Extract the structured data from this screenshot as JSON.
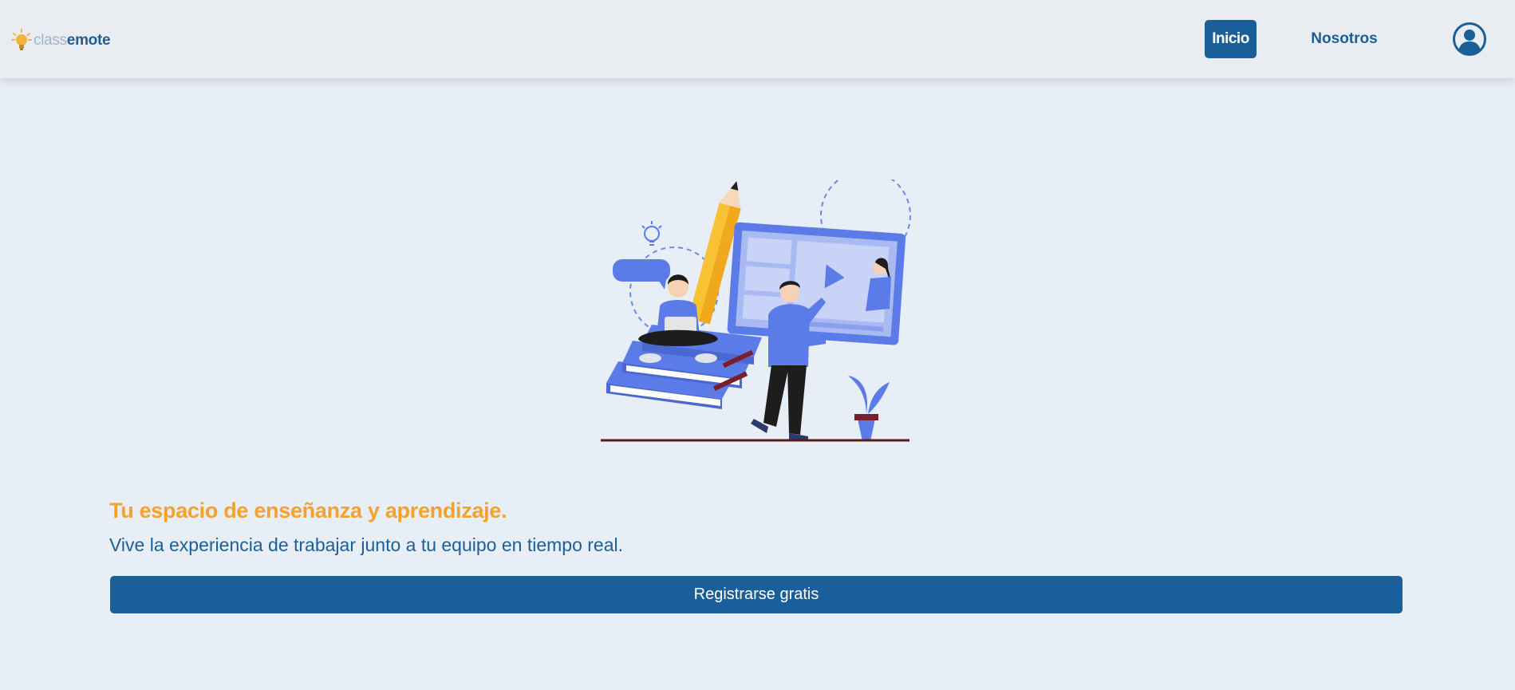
{
  "brand": {
    "name_light": "class",
    "name_bold": "emote",
    "icon": "lightbulb-icon"
  },
  "nav": {
    "items": [
      {
        "label": "Inicio",
        "active": true
      },
      {
        "label": "Nosotros",
        "active": false
      }
    ],
    "user_icon": "user-circle-icon"
  },
  "hero": {
    "title": "Tu espacio de enseñanza y aprendizaje.",
    "subtitle": "Vive la experiencia de trabajar junto a tu equipo en tiempo real.",
    "cta_label": "Registrarse gratis"
  },
  "colors": {
    "primary": "#1a5f99",
    "accent": "#f5a12e",
    "background": "#e8eef5",
    "navbar": "#e9edf1",
    "illustration_blue": "#5b7ce8"
  }
}
